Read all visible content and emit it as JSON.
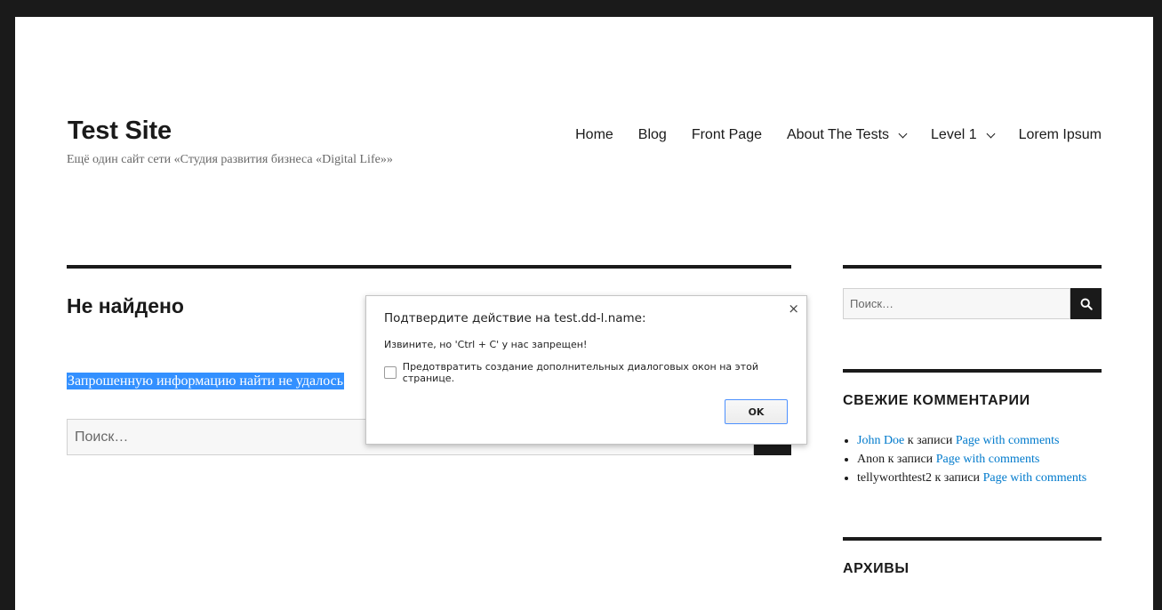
{
  "site": {
    "title": "Test Site",
    "description": "Ещё один сайт сети «Студия развития бизнеса «Digital Life»»"
  },
  "nav": {
    "home": "Home",
    "blog": "Blog",
    "front_page": "Front Page",
    "about": "About The Tests",
    "level1": "Level 1",
    "lorem": "Lorem Ipsum"
  },
  "main": {
    "page_title": "Не найдено",
    "message": "Запрошенную информацию найти не удалось",
    "search_placeholder": "Поиск…"
  },
  "sidebar": {
    "search_placeholder": "Поиск…",
    "recent_comments_title": "СВЕЖИЕ КОММЕНТАРИИ",
    "comments": [
      {
        "author": "John Doe",
        "joiner": " к записи ",
        "post": "Page with comments"
      },
      {
        "author": "Anon",
        "joiner": " к записи ",
        "post": "Page with comments"
      },
      {
        "author": "tellyworthtest2",
        "joiner": " к записи ",
        "post": "Page with comments"
      }
    ],
    "archives_title": "АРХИВЫ"
  },
  "dialog": {
    "title": "Подтвердите действие на test.dd-l.name:",
    "message": "Извините, но 'Ctrl + C' у нас запрещен!",
    "checkbox_label": "Предотвратить создание дополнительных диалоговых окон на этой странице.",
    "ok_label": "OK",
    "close_glyph": "×"
  },
  "colors": {
    "link": "#007acc",
    "selection": "#3390ff",
    "dark": "#1a1a1a"
  }
}
